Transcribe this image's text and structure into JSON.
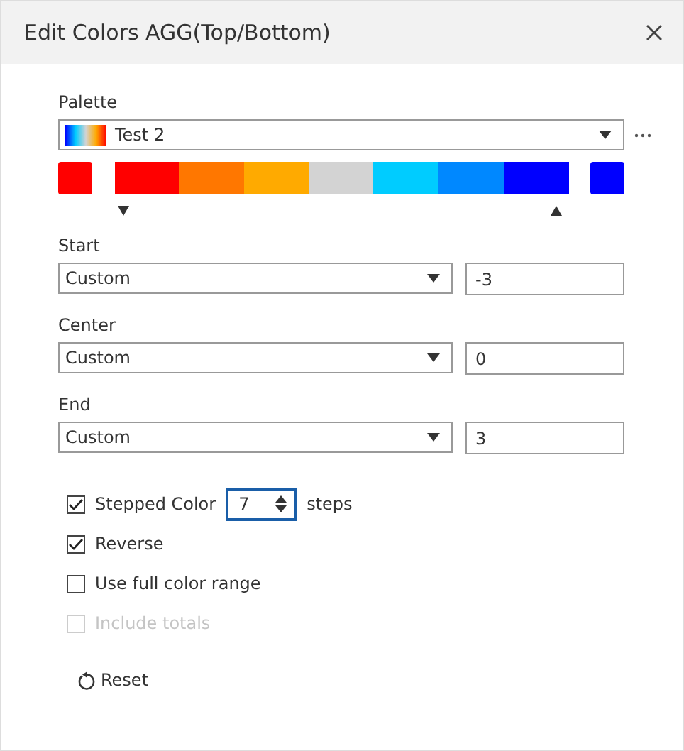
{
  "window": {
    "title": "Edit Colors AGG(Top/Bottom)"
  },
  "palette": {
    "label": "Palette",
    "value": "Test 2",
    "end_swatches": [
      {
        "color": "#ff0000"
      },
      {
        "color": "#0000ff"
      }
    ],
    "steps": [
      {
        "color": "#ff0000"
      },
      {
        "color": "#ff7700"
      },
      {
        "color": "#ffaa00"
      },
      {
        "color": "#d3d3d3"
      },
      {
        "color": "#00ccff"
      },
      {
        "color": "#0088ff"
      },
      {
        "color": "#0000ff"
      }
    ]
  },
  "ranges": [
    {
      "label": "Start",
      "mode": "Custom",
      "value": "-3"
    },
    {
      "label": "Center",
      "mode": "Custom",
      "value": "0"
    },
    {
      "label": "End",
      "mode": "Custom",
      "value": "3"
    }
  ],
  "options": [
    {
      "kind": "stepper",
      "label": "Stepped Color",
      "checked": true,
      "disabled": false,
      "steps_value": "7",
      "unit": "steps"
    },
    {
      "kind": "check",
      "label": "Reverse",
      "checked": true,
      "disabled": false
    },
    {
      "kind": "check",
      "label": "Use full color range",
      "checked": false,
      "disabled": false
    },
    {
      "kind": "check",
      "label": "Include totals",
      "checked": false,
      "disabled": true
    }
  ],
  "reset": {
    "label": "Reset"
  }
}
